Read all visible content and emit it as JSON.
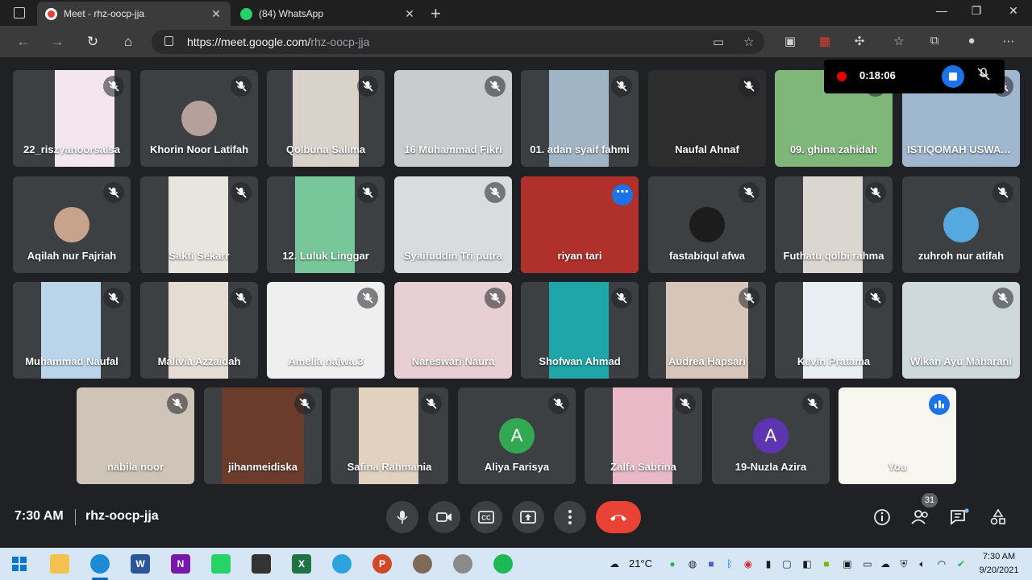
{
  "browser": {
    "tabs": [
      {
        "label": "Meet - rhz-oocp-jja",
        "active": true
      },
      {
        "label": "(84) WhatsApp",
        "active": false
      }
    ],
    "url_host": "https://meet.google.com/",
    "url_path": "rhz-oocp-jja"
  },
  "recording": {
    "time": "0:18:06"
  },
  "participants": [
    {
      "name": "22_riszyanoorsalsa",
      "state": "muted"
    },
    {
      "name": "Khorin Noor Latifah",
      "state": "muted"
    },
    {
      "name": "Qolbuna Salima",
      "state": "muted"
    },
    {
      "name": "16 Muhammad Fikri",
      "state": "muted"
    },
    {
      "name": "01. adan syaif fahmi",
      "state": "muted"
    },
    {
      "name": "Naufal Ahnaf",
      "state": "muted"
    },
    {
      "name": "09. ghina zahidah",
      "state": "muted"
    },
    {
      "name": "ISTIQOMAH USWATUN",
      "state": "muted"
    },
    {
      "name": "Aqilah nur Fajriah",
      "state": "muted"
    },
    {
      "name": "Sakti Sekarr",
      "state": "muted"
    },
    {
      "name": "12. Luluk Linggar",
      "state": "muted"
    },
    {
      "name": "Syaifuddin Tri putra",
      "state": "muted"
    },
    {
      "name": "riyan tari",
      "state": "speaking"
    },
    {
      "name": "fastabiqul afwa",
      "state": "muted"
    },
    {
      "name": "Futhatu qolbi rahma",
      "state": "muted"
    },
    {
      "name": "zuhroh nur atifah",
      "state": "muted"
    },
    {
      "name": "Muhammad Naufal",
      "state": "muted"
    },
    {
      "name": "Malivia Azzaidah",
      "state": "muted"
    },
    {
      "name": "Amelia najwa.3",
      "state": "muted"
    },
    {
      "name": "Nareswari Naura",
      "state": "muted"
    },
    {
      "name": "Shofwan Ahmad",
      "state": "muted"
    },
    {
      "name": "Audrea Hapsari",
      "state": "muted"
    },
    {
      "name": "Kevin Pratama",
      "state": "muted"
    },
    {
      "name": "Wikan Ayu Maharani",
      "state": "muted"
    },
    {
      "name": "nabila noor",
      "state": "muted"
    },
    {
      "name": "jihanmeidiska",
      "state": "muted"
    },
    {
      "name": "Safina Rahmania",
      "state": "muted"
    },
    {
      "name": "Aliya Farisya",
      "state": "muted",
      "initial": "A"
    },
    {
      "name": "Zalfa Sabrina",
      "state": "muted"
    },
    {
      "name": "19-Nuzla Azira",
      "state": "muted",
      "initial": "A"
    },
    {
      "name": "You",
      "state": "talking"
    }
  ],
  "bottom": {
    "time": "7:30 AM",
    "meeting_code": "rhz-oocp-jja",
    "people_count": "31"
  },
  "taskbar": {
    "temperature": "21°C",
    "clock_time": "7:30 AM",
    "clock_date": "9/20/2021"
  },
  "colors": {
    "background": "#202124",
    "tile": "#3c4043",
    "end_call": "#ea4335",
    "accent": "#1a73e8",
    "avatar_green": "#33a852",
    "avatar_purple": "#5e35b1"
  }
}
